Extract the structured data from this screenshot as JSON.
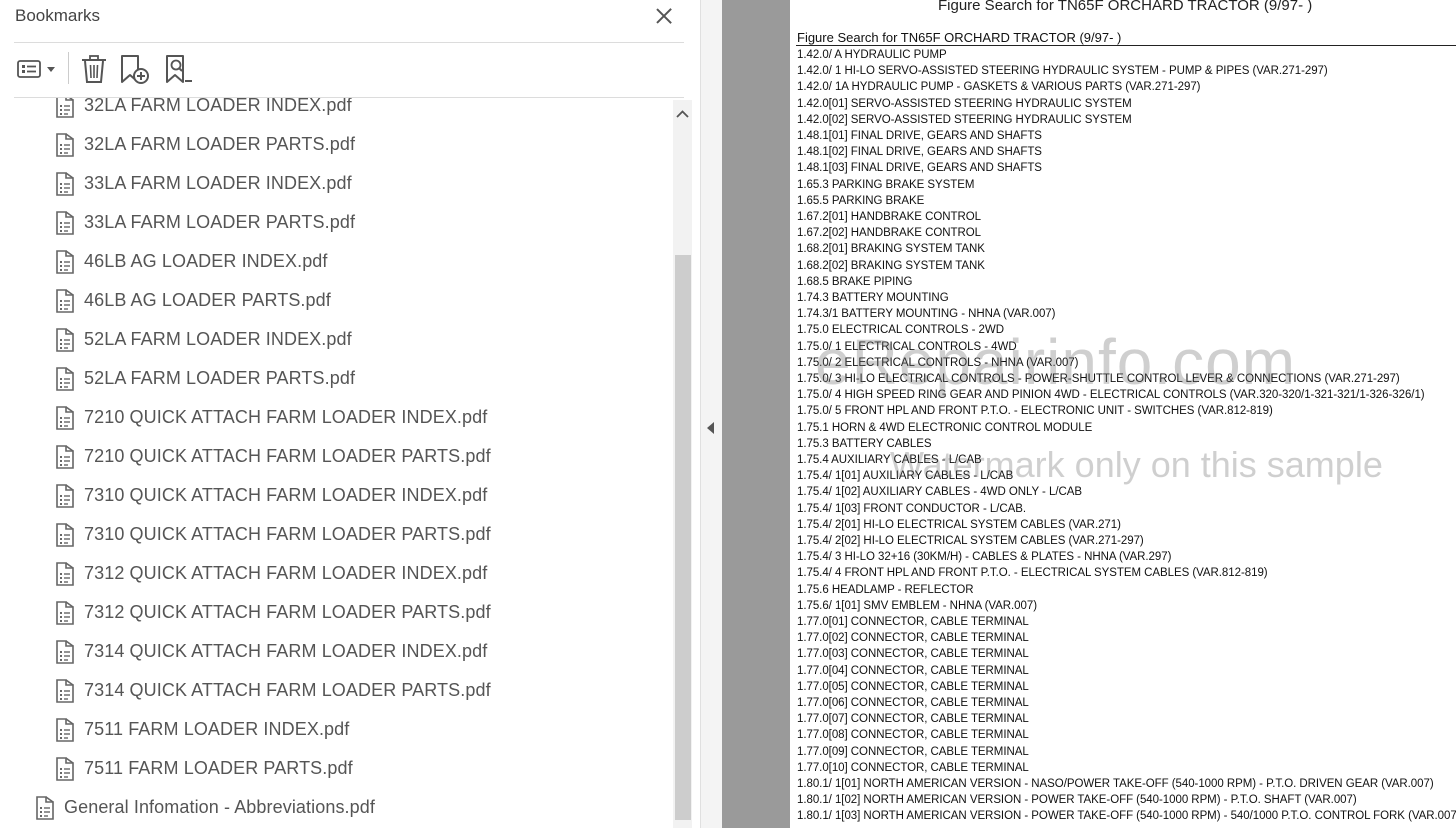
{
  "bookmarks_panel": {
    "title": "Bookmarks",
    "toolbar": {
      "options_icon": "list-options-icon",
      "delete_icon": "trash-icon",
      "new_bookmark_icon": "add-bookmark-icon",
      "find_bookmark_icon": "find-bookmark-icon"
    },
    "items": [
      {
        "label": "32LA FARM LOADER INDEX.pdf",
        "level": 2
      },
      {
        "label": "32LA FARM LOADER PARTS.pdf",
        "level": 2
      },
      {
        "label": "33LA FARM LOADER INDEX.pdf",
        "level": 2
      },
      {
        "label": "33LA FARM LOADER PARTS.pdf",
        "level": 2
      },
      {
        "label": "46LB AG LOADER INDEX.pdf",
        "level": 2
      },
      {
        "label": "46LB AG LOADER PARTS.pdf",
        "level": 2
      },
      {
        "label": "52LA FARM LOADER INDEX.pdf",
        "level": 2
      },
      {
        "label": "52LA FARM LOADER PARTS.pdf",
        "level": 2
      },
      {
        "label": "7210 QUICK ATTACH FARM LOADER INDEX.pdf",
        "level": 2
      },
      {
        "label": "7210 QUICK ATTACH FARM LOADER PARTS.pdf",
        "level": 2
      },
      {
        "label": "7310 QUICK ATTACH FARM LOADER INDEX.pdf",
        "level": 2
      },
      {
        "label": "7310 QUICK ATTACH FARM LOADER PARTS.pdf",
        "level": 2
      },
      {
        "label": "7312 QUICK ATTACH FARM LOADER INDEX.pdf",
        "level": 2
      },
      {
        "label": "7312 QUICK ATTACH FARM LOADER PARTS.pdf",
        "level": 2
      },
      {
        "label": "7314 QUICK ATTACH FARM LOADER INDEX.pdf",
        "level": 2
      },
      {
        "label": "7314 QUICK ATTACH FARM LOADER PARTS.pdf",
        "level": 2
      },
      {
        "label": "7511 FARM LOADER INDEX.pdf",
        "level": 2
      },
      {
        "label": "7511 FARM LOADER PARTS.pdf",
        "level": 2
      },
      {
        "label": "General Infomation - Abbreviations.pdf",
        "level": 1
      }
    ]
  },
  "document": {
    "top_title": "Figure Search for TN65F ORCHARD TRACTOR (9/97- )",
    "header": "Figure Search for TN65F ORCHARD TRACTOR (9/97- )",
    "watermark": "eRepairinfo.com",
    "watermark_sub": "Watermark only on this sample",
    "entries": [
      "1.42.0/  A HYDRAULIC PUMP",
      "1.42.0/ 1 HI-LO SERVO-ASSISTED STEERING HYDRAULIC SYSTEM - PUMP & PIPES (VAR.271-297)",
      "1.42.0/ 1A HYDRAULIC PUMP - GASKETS & VARIOUS PARTS (VAR.271-297)",
      "1.42.0[01] SERVO-ASSISTED STEERING HYDRAULIC SYSTEM",
      "1.42.0[02] SERVO-ASSISTED STEERING HYDRAULIC SYSTEM",
      "1.48.1[01] FINAL DRIVE, GEARS AND SHAFTS",
      "1.48.1[02] FINAL DRIVE, GEARS AND SHAFTS",
      "1.48.1[03] FINAL DRIVE, GEARS AND SHAFTS",
      "1.65.3 PARKING BRAKE SYSTEM",
      "1.65.5 PARKING BRAKE",
      "1.67.2[01] HANDBRAKE CONTROL",
      "1.67.2[02] HANDBRAKE CONTROL",
      "1.68.2[01] BRAKING SYSTEM TANK",
      "1.68.2[02] BRAKING SYSTEM TANK",
      "1.68.5 BRAKE PIPING",
      "1.74.3 BATTERY MOUNTING",
      "1.74.3/1 BATTERY MOUNTING - NHNA (VAR.007)",
      "1.75.0 ELECTRICAL CONTROLS - 2WD",
      "1.75.0/ 1 ELECTRICAL CONTROLS - 4WD",
      "1.75.0/ 2 ELECTRICAL CONTROLS - NHNA (VAR.007)",
      "1.75.0/ 3 HI-LO ELECTRICAL CONTROLS - POWER-SHUTTLE CONTROL LEVER & CONNECTIONS (VAR.271-297)",
      "1.75.0/ 4 HIGH SPEED RING GEAR AND PINION 4WD - ELECTRICAL CONTROLS (VAR.320-320/1-321-321/1-326-326/1)",
      "1.75.0/ 5 FRONT HPL AND FRONT P.T.O. - ELECTRONIC UNIT - SWITCHES (VAR.812-819)",
      "1.75.1 HORN & 4WD ELECTRONIC CONTROL MODULE",
      "1.75.3 BATTERY CABLES",
      "1.75.4 AUXILIARY CABLES - L/CAB",
      "1.75.4/ 1[01] AUXILIARY CABLES - L/CAB",
      "1.75.4/ 1[02] AUXILIARY CABLES - 4WD ONLY - L/CAB",
      "1.75.4/ 1[03] FRONT CONDUCTOR - L/CAB.",
      "1.75.4/ 2[01] HI-LO ELECTRICAL SYSTEM CABLES (VAR.271)",
      "1.75.4/ 2[02] HI-LO ELECTRICAL SYSTEM CABLES (VAR.271-297)",
      "1.75.4/ 3 HI-LO 32+16 (30KM/H) - CABLES & PLATES - NHNA (VAR.297)",
      "1.75.4/ 4 FRONT HPL AND FRONT P.T.O. - ELECTRICAL SYSTEM CABLES (VAR.812-819)",
      "1.75.6 HEADLAMP - REFLECTOR",
      "1.75.6/ 1[01] SMV EMBLEM - NHNA (VAR.007)",
      "1.77.0[01] CONNECTOR, CABLE TERMINAL",
      "1.77.0[02] CONNECTOR, CABLE TERMINAL",
      "1.77.0[03] CONNECTOR, CABLE TERMINAL",
      "1.77.0[04] CONNECTOR, CABLE TERMINAL",
      "1.77.0[05] CONNECTOR, CABLE TERMINAL",
      "1.77.0[06] CONNECTOR, CABLE TERMINAL",
      "1.77.0[07] CONNECTOR, CABLE TERMINAL",
      "1.77.0[08] CONNECTOR, CABLE TERMINAL",
      "1.77.0[09] CONNECTOR, CABLE TERMINAL",
      "1.77.0[10] CONNECTOR, CABLE TERMINAL",
      "1.80.1/ 1[01] NORTH AMERICAN VERSION - NASO/POWER TAKE-OFF (540-1000 RPM) - P.T.O. DRIVEN GEAR (VAR.007)",
      "1.80.1/ 1[02] NORTH AMERICAN VERSION - POWER TAKE-OFF (540-1000 RPM) - P.T.O. SHAFT (VAR.007)",
      "1.80.1/ 1[03] NORTH AMERICAN VERSION - POWER TAKE-OFF (540-1000 RPM) - 540/1000 P.T.O. CONTROL FORK (VAR.007)"
    ]
  }
}
